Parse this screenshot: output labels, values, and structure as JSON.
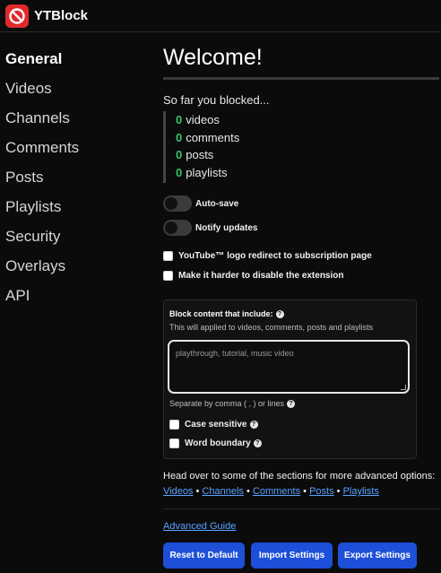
{
  "app": {
    "name": "YTBlock"
  },
  "sidebar": {
    "items": [
      {
        "label": "General"
      },
      {
        "label": "Videos"
      },
      {
        "label": "Channels"
      },
      {
        "label": "Comments"
      },
      {
        "label": "Posts"
      },
      {
        "label": "Playlists"
      },
      {
        "label": "Security"
      },
      {
        "label": "Overlays"
      },
      {
        "label": "API"
      }
    ],
    "active": "General"
  },
  "main": {
    "title": "Welcome!",
    "blocked_intro": "So far you blocked...",
    "stats": [
      {
        "count": "0",
        "label": "videos"
      },
      {
        "count": "0",
        "label": "comments"
      },
      {
        "count": "0",
        "label": "posts"
      },
      {
        "count": "0",
        "label": "playlists"
      }
    ],
    "toggles": [
      {
        "label": "Auto-save",
        "on": false
      },
      {
        "label": "Notify updates",
        "on": false
      }
    ],
    "checkboxes": [
      {
        "label": "YouTube™ logo redirect to subscription page",
        "checked": false
      },
      {
        "label": "Make it harder to disable the extension",
        "checked": false
      }
    ],
    "block_panel": {
      "title": "Block content that include:",
      "subtitle": "This will applied to videos, comments, posts and playlists",
      "input_value": "",
      "placeholder": "playthrough, tutorial, music video",
      "separator_hint": "Separate by comma ( , ) or lines",
      "case_sensitive_label": "Case sensitive",
      "case_sensitive_checked": false,
      "word_boundary_label": "Word boundary",
      "word_boundary_checked": false
    },
    "advanced_text": "Head over to some of the sections for more advanced options:",
    "section_links": [
      "Videos",
      "Channels",
      "Comments",
      "Posts",
      "Playlists"
    ],
    "link_separator": "•",
    "guide_link": "Advanced Guide",
    "buttons": {
      "reset": "Reset to Default",
      "import": "Import Settings",
      "export": "Export Settings"
    }
  },
  "colors": {
    "accent_button": "#1e4fd8",
    "stat_number": "#35c46a",
    "link": "#5aa2ff",
    "logo": "#e02a2a"
  },
  "icons": {
    "logo": "no-entry-icon",
    "help": "question-circle-icon"
  }
}
